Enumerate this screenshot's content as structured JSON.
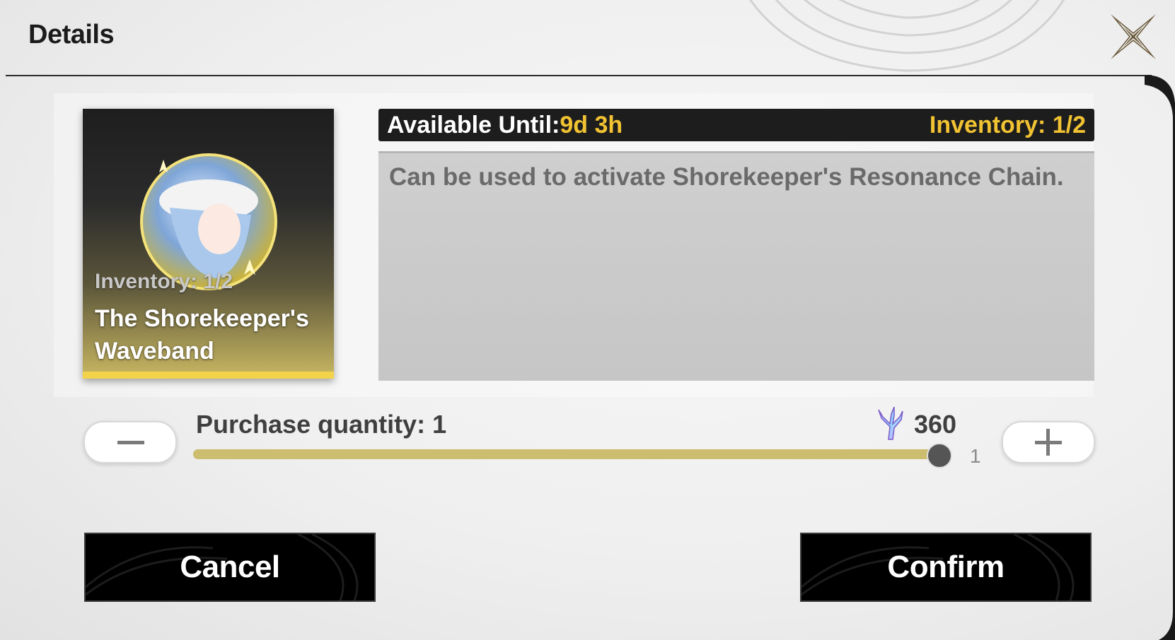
{
  "header": {
    "title": "Details"
  },
  "item": {
    "card_inventory": "Inventory: 1/2",
    "name": "The Shorekeeper's Waveband"
  },
  "info_bar": {
    "available_label": "Available Until:",
    "available_value": "9d 3h",
    "inventory": "Inventory: 1/2"
  },
  "description": "Can be used to activate Shorekeeper's Resonance Chain.",
  "purchase": {
    "quantity_label": "Purchase quantity: 1",
    "price": "360",
    "slider_max": "1",
    "slider_fraction": 1.0
  },
  "buttons": {
    "cancel": "Cancel",
    "confirm": "Confirm"
  },
  "colors": {
    "accent_gold": "#f1c232",
    "slider_fill": "#cdbd6e",
    "card_bar": "#f3d34a"
  },
  "icons": {
    "close": "close-icon",
    "minus": "minus-icon",
    "plus": "plus-icon",
    "currency": "coral-currency-icon"
  }
}
